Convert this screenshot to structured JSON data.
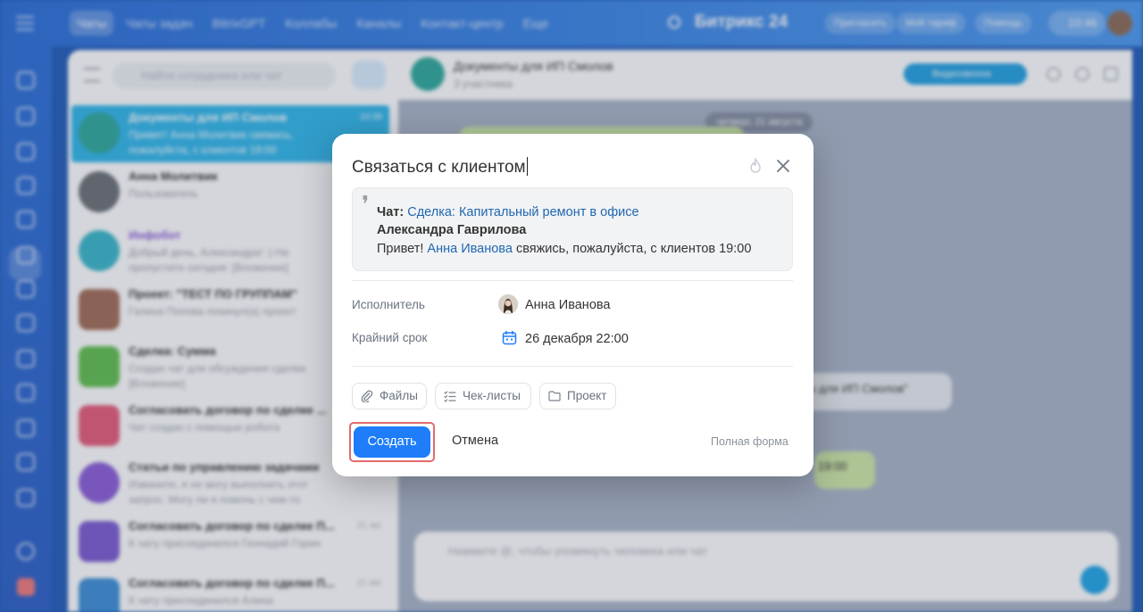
{
  "topbar": {
    "tabs": [
      "Чаты",
      "Чаты задач",
      "BitrixGPT",
      "Коллабы",
      "Каналы",
      "Контакт-центр",
      "Еще"
    ],
    "brand": "Битрикс 24",
    "invite": "Пригласить",
    "my_plan": "Мой тариф",
    "help": "Помощь",
    "time": "10:46"
  },
  "chatlist": {
    "search_placeholder": "Найти сотрудника или чат",
    "items": [
      {
        "title": "Документы для ИП Смолов",
        "subtitle": "Привет! Анна Молитвик свяжись, пожалуйста, с клиентов 19:00",
        "time": "10:39"
      },
      {
        "title": "Анна Молитвик",
        "subtitle": "Пользователь",
        "time": ""
      },
      {
        "title": "Инфобот",
        "subtitle": "Добрый день, Александра! :) Не пропустите сегодня: [Вложение]",
        "time": ""
      },
      {
        "title": "Проект: \"ТЕСТ ПО ГРУППАМ\"",
        "subtitle": "Галина Попова покинул(а) проект",
        "time": ""
      },
      {
        "title": "Сделка: Сумма",
        "subtitle": "Создан чат для обсуждения сделки [Вложение]",
        "time": ""
      },
      {
        "title": "Согласовать договор по сделке ...",
        "subtitle": "Чат создан с помощью робота",
        "time": ""
      },
      {
        "title": "Статьи по управлению задачами",
        "subtitle": "Извините, я не могу выполнить этот запрос. Могу ли я помочь с чем-то",
        "time": ""
      },
      {
        "title": "Согласовать договор по сделке П...",
        "subtitle": "К чату присоединился Геннадий Горин",
        "time": "21 авг"
      },
      {
        "title": "Согласовать договор по сделке П...",
        "subtitle": "К чату присоединился Алина",
        "time": "21 авг"
      }
    ]
  },
  "chatpane": {
    "title": "Документы для ИП Смолов",
    "subtitle": "3 участника",
    "video_call": "Видеозвонок",
    "date_pill": "четверг, 21 августа",
    "message_fragment": "ты для ИП Смолов\"",
    "message_time_fragment": "19:00",
    "composer_placeholder": "Нажмите @, чтобы упомянуть человека или чат"
  },
  "modal": {
    "title": "Связаться с клиентом",
    "quote": {
      "chat_label": "Чат:",
      "chat_link": "Сделка: Капитальный ремонт в офисе",
      "author": "Александра Гаврилова",
      "text_before": "Привет!",
      "mention": "Анна Иванова",
      "text_after": "свяжись, пожалуйста, с клиентов 19:00"
    },
    "assignee_label": "Исполнитель",
    "assignee": "Анна Иванова",
    "deadline_label": "Крайний срок",
    "deadline": "26 декабря 22:00",
    "chips": {
      "files": "Файлы",
      "checklists": "Чек-листы",
      "project": "Проект"
    },
    "create_label": "Создать",
    "cancel_label": "Отмена",
    "full_form_label": "Полная форма"
  },
  "colors": {
    "accent": "#1f7dfa",
    "link": "#2067b0",
    "highlight_outline": "#e06b6b"
  }
}
